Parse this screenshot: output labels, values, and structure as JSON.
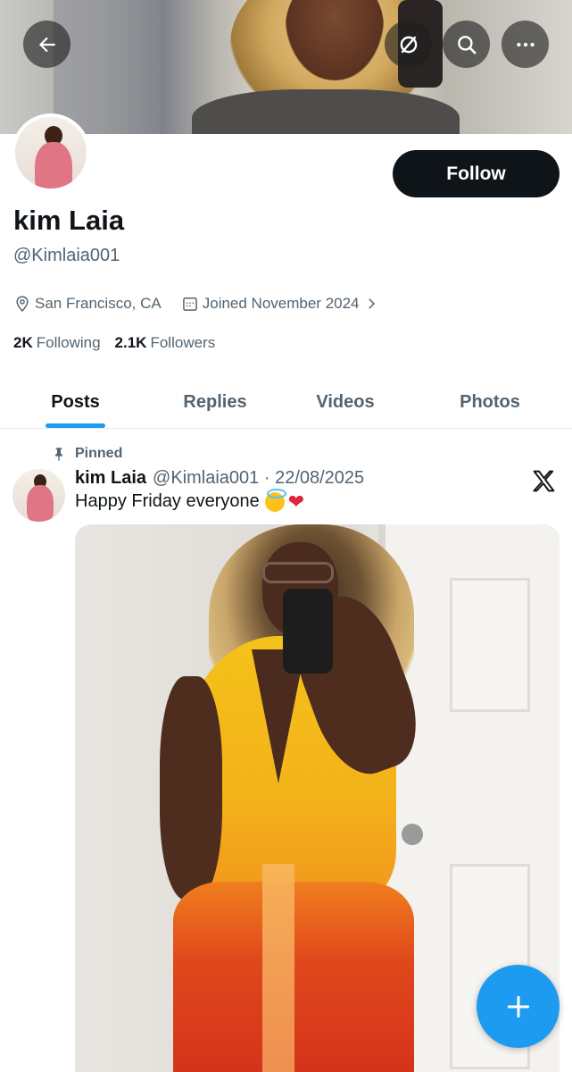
{
  "header": {
    "back_icon": "arrow-left-icon",
    "grok_icon": "grok-icon",
    "search_icon": "search-icon",
    "more_icon": "more-horizontal-icon"
  },
  "profile": {
    "display_name": "kim Laia",
    "handle": "@Kimlaia001",
    "location": "San Francisco, CA",
    "joined": "Joined November 2024",
    "following_count": "2K",
    "following_label": "Following",
    "followers_count": "2.1K",
    "followers_label": "Followers",
    "follow_label": "Follow"
  },
  "tabs": [
    {
      "label": "Posts",
      "active": true
    },
    {
      "label": "Replies",
      "active": false
    },
    {
      "label": "Videos",
      "active": false
    },
    {
      "label": "Photos",
      "active": false
    }
  ],
  "post": {
    "pinned_label": "Pinned",
    "author_name": "kim Laia",
    "meta": "@Kimlaia001 · 22/08/2025",
    "text": "Happy Friday everyone",
    "emojis": [
      "smiling-face-with-halo",
      "red-heart"
    ]
  },
  "colors": {
    "accent": "#1d9bf0",
    "text_primary": "#0f1419",
    "text_secondary": "#536471",
    "follow_button": "#0f1419"
  },
  "fab": {
    "icon": "plus-icon"
  }
}
